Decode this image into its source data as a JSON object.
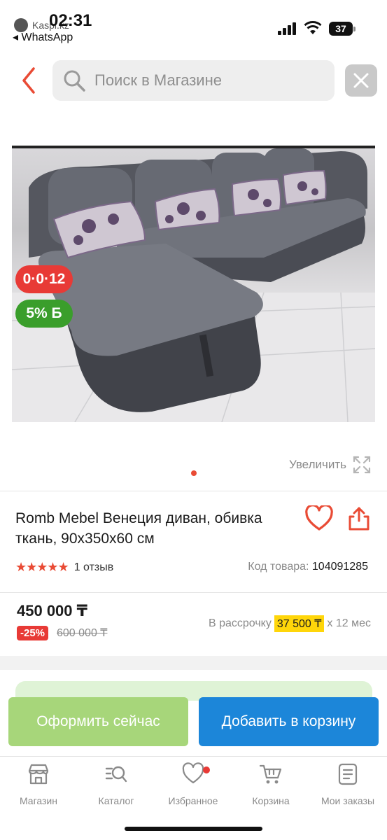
{
  "status_bar": {
    "time": "02:31",
    "carrier_app": "Kaspi.kz",
    "back_to_app": "◂ WhatsApp",
    "battery": "37"
  },
  "search": {
    "placeholder": "Поиск в Магазине"
  },
  "product": {
    "image_icon": "sofa-photo",
    "badges": {
      "installment": "0·0·12",
      "bonus": "5% Б"
    },
    "zoom_label": "Увеличить",
    "title": "Romb Mebel Венеция диван, обивка ткань, 90x350x60 см",
    "rating_stars": "★★★★★",
    "rating_value": 5,
    "reviews": "1 отзыв",
    "code_label": "Код товара:",
    "code_value": "104091285",
    "price": "450 000 ₸",
    "discount": "-25%",
    "old_price": "600 000 ₸",
    "installment_label": "В рассрочку",
    "installment_monthly": "37 500 ₸",
    "installment_term": "x 12 мес"
  },
  "actions": {
    "buy_now": "Оформить сейчас",
    "add_to_cart": "Добавить в корзину"
  },
  "tabbar": [
    {
      "label": "Магазин",
      "icon": "store-icon"
    },
    {
      "label": "Каталог",
      "icon": "catalog-icon"
    },
    {
      "label": "Избранное",
      "icon": "heart-icon"
    },
    {
      "label": "Корзина",
      "icon": "cart-icon"
    },
    {
      "label": "Мои заказы",
      "icon": "orders-icon"
    }
  ],
  "colors": {
    "accent_red": "#e94b35",
    "bonus_green": "#3a9e2b",
    "buy_green": "#a7d67a",
    "cart_blue": "#1c86d9",
    "installment_yellow": "#ffd60a"
  }
}
